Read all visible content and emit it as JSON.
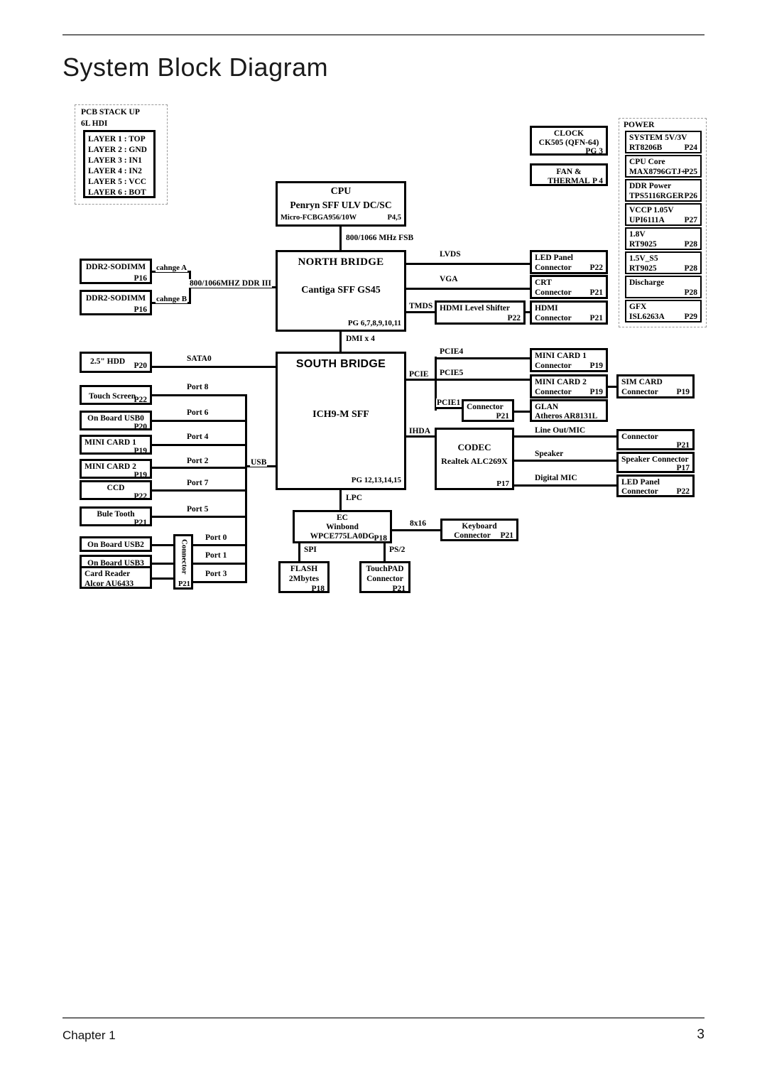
{
  "document": {
    "title": "System Block Diagram",
    "footer_left": "Chapter 1",
    "footer_page": "3"
  },
  "diagram": {
    "type": "system-block-diagram",
    "pcb_stack": {
      "heading_line1": "PCB STACK UP",
      "heading_line2": "6L HDI",
      "layers": [
        "LAYER 1 : TOP",
        "LAYER 2 : GND",
        "LAYER 3 : IN1",
        "LAYER 4 : IN2",
        "LAYER 5 : VCC",
        "LAYER 6 : BOT"
      ]
    },
    "clock": {
      "title": "CLOCK",
      "part": "CK505 (QFN-64)",
      "page": "PG 3"
    },
    "fan_thermal": {
      "title": "FAN & THERMAL",
      "page": "P 4"
    },
    "power": {
      "heading": "POWER",
      "rails": [
        {
          "name": "SYSTEM 5V/3V",
          "part": "RT8206B",
          "page": "P24"
        },
        {
          "name": "CPU Core",
          "part": "MAX8796GTJ+",
          "page": "P25"
        },
        {
          "name": "DDR Power",
          "part": "TPS5116RGER",
          "page": "P26"
        },
        {
          "name": "VCCP 1.05V",
          "part": "UPI6111A",
          "page": "P27"
        },
        {
          "name": "1.8V",
          "part": "RT9025",
          "page": "P28"
        },
        {
          "name": "1.5V_S5",
          "part": "RT9025",
          "page": "P28"
        },
        {
          "name": "Discharge",
          "part": "",
          "page": "P28"
        },
        {
          "name": "GFX",
          "part": "ISL6263A",
          "page": "P29"
        }
      ]
    },
    "cpu": {
      "title": "CPU",
      "model": "Penryn SFF ULV DC/SC",
      "package": "Micro-FCBGA956/10W",
      "page": "P4,5"
    },
    "north_bridge": {
      "title": "NORTH BRIDGE",
      "model": "Cantiga SFF GS45",
      "page": "PG 6,7,8,9,10,11"
    },
    "south_bridge": {
      "title": "SOUTH BRIDGE",
      "model": "ICH9-M SFF",
      "page": "PG 12,13,14,15"
    },
    "bus_labels": {
      "fsb": "800/1066 MHz FSB",
      "ddr": "800/1066MHZ DDR III",
      "dmi": "DMI x 4",
      "lvds": "LVDS",
      "vga": "VGA",
      "tmds": "TMDS",
      "sata0": "SATA0",
      "usb": "USB",
      "pcie": "PCIE",
      "pcie4": "PCIE4",
      "pcie5": "PCIE5",
      "pcie1": "PCIE1",
      "ihda": "IHDA",
      "lpc": "LPC",
      "spi": "SPI",
      "ps2": "PS/2",
      "kbd_matrix": "8x16",
      "line_out_mic": "Line Out/MIC",
      "speaker": "Speaker",
      "digital_mic": "Digital MIC",
      "channel_a": "cahnge A",
      "channel_b": "cahnge B"
    },
    "memory": [
      {
        "name": "DDR2-SODIMM",
        "page": "P16"
      },
      {
        "name": "DDR2-SODIMM",
        "page": "P16"
      }
    ],
    "display_chain": {
      "led_panel": {
        "line1": "LED Panel",
        "line2": "Connector",
        "page": "P22"
      },
      "crt": {
        "line1": "CRT",
        "line2": "Connector",
        "page": "P21"
      },
      "hdmi_level_shifter": {
        "line1": "HDMI Level Shifter",
        "page": "P22"
      },
      "hdmi_connector": {
        "line1": "HDMI",
        "line2": "Connector",
        "page": "P21"
      }
    },
    "storage": {
      "name": "2.5\" HDD",
      "page": "P20"
    },
    "usb_devices": [
      {
        "name": "Touch Screen",
        "page": "P22",
        "port": "Port 8"
      },
      {
        "name": "On Board USB0",
        "page": "P20",
        "port": "Port 6"
      },
      {
        "name": "MINI CARD 1",
        "page": "P19",
        "port": "Port 4"
      },
      {
        "name": "MINI CARD 2",
        "page": "P19",
        "port": "Port 2"
      },
      {
        "name": "CCD",
        "page": "P22",
        "port": "Port 7"
      },
      {
        "name": "Bule Tooth",
        "page": "P21",
        "port": "Port 5"
      }
    ],
    "usb_connector_devices": [
      {
        "name": "On Board USB2",
        "page": "",
        "port": "Port 0"
      },
      {
        "name": "On Board USB3",
        "page": "",
        "port": "Port 1"
      },
      {
        "name": "Card Reader",
        "name2": "Alcor AU6433",
        "page": "",
        "port": "Port 3"
      }
    ],
    "usb_connector": {
      "label": "Connector",
      "page": "P21"
    },
    "pcie_devices": {
      "mini_card_1": {
        "line1": "MINI CARD 1",
        "line2": "Connector",
        "page": "P19"
      },
      "mini_card_2": {
        "line1": "MINI CARD 2",
        "line2": "Connector",
        "page": "P19"
      },
      "sim_card": {
        "line1": "SIM CARD",
        "line2": "Connector",
        "page": "P19"
      },
      "lan_connector": {
        "line1": "Connector",
        "page": "P21"
      },
      "glan": {
        "line1": "GLAN",
        "line2": "Atheros AR8131L"
      }
    },
    "audio": {
      "codec": {
        "title": "CODEC",
        "part": "Realtek ALC269X",
        "page": "P17"
      },
      "line_out_connector": {
        "line1": "Connector",
        "page": "P21"
      },
      "speaker_connector": {
        "line1": "Speaker Connector",
        "page": "P17"
      },
      "dmic_connector": {
        "line1": "LED Panel",
        "line2": "Connector",
        "page": "P22"
      }
    },
    "ec": {
      "title": "EC",
      "part": "Winbond WPCE775LA0DG",
      "page": "P18"
    },
    "ec_devices": {
      "keyboard": {
        "line1": "Keyboard",
        "line2": "Connector",
        "page": "P21"
      },
      "flash": {
        "line1": "FLASH",
        "line2": "2Mbytes",
        "page": "P18"
      },
      "touchpad": {
        "line1": "TouchPAD",
        "line2": "Connector",
        "page": "P21"
      }
    }
  }
}
